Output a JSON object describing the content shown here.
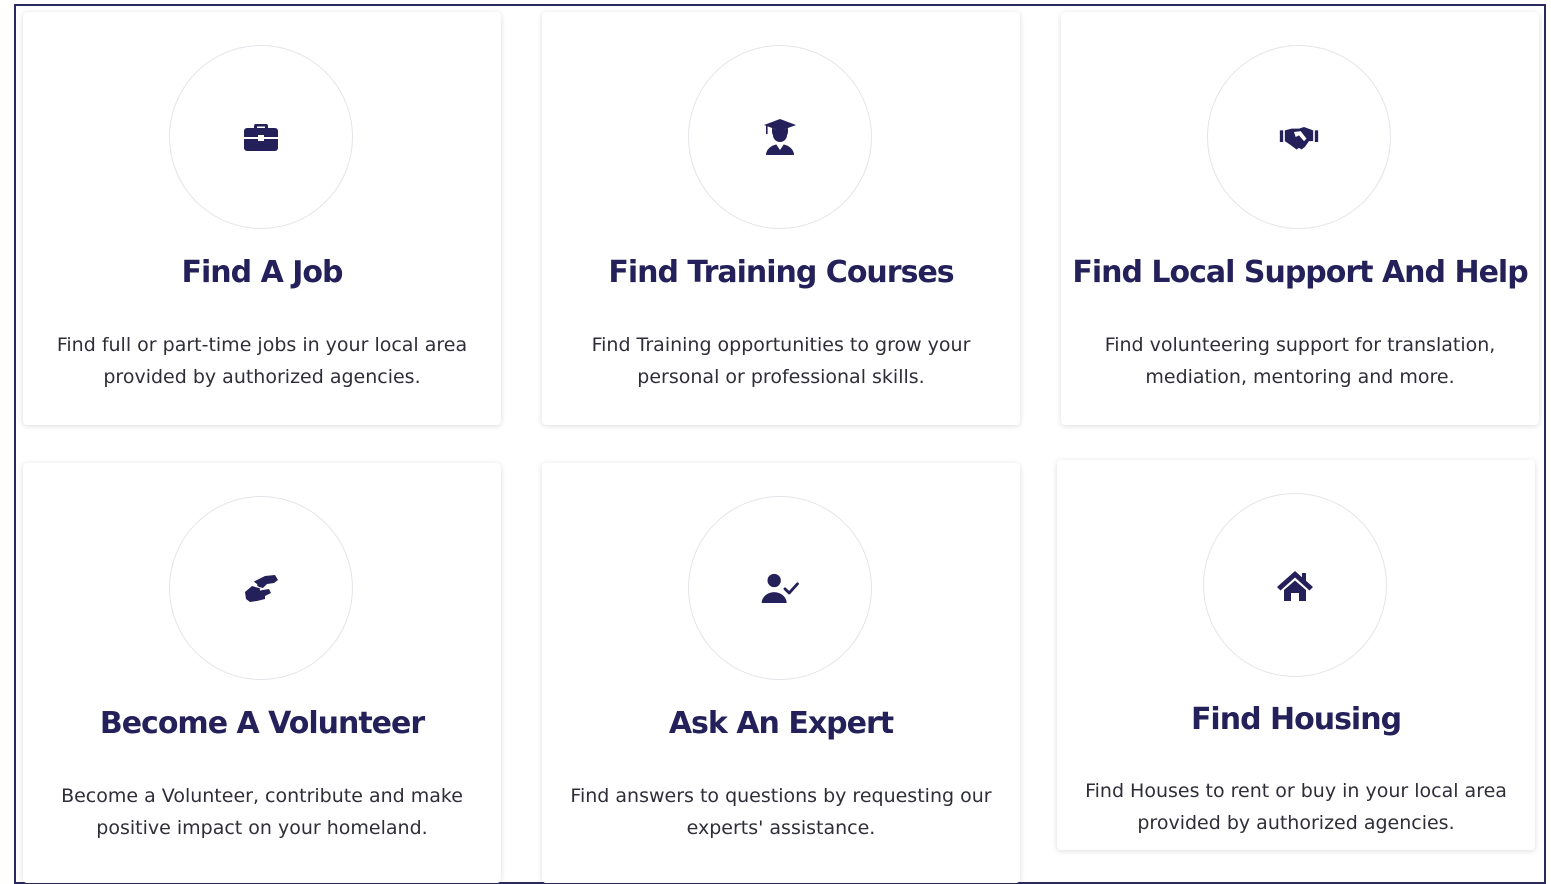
{
  "cards": [
    {
      "title": "Find A Job",
      "description": "Find full or part-time jobs in your local area provided by authorized agencies.",
      "icon": "briefcase-icon"
    },
    {
      "title": "Find Training Courses",
      "description": "Find Training opportunities to grow your personal or professional skills.",
      "icon": "graduate-icon"
    },
    {
      "title": "Find Local Support And Help",
      "description": "Find volunteering support for translation, mediation, mentoring and more.",
      "icon": "handshake-icon"
    },
    {
      "title": "Become A Volunteer",
      "description": "Become a Volunteer, contribute and make positive impact on your homeland.",
      "icon": "hands-helping-icon"
    },
    {
      "title": "Ask An Expert",
      "description": "Find answers to questions by requesting our experts' assistance.",
      "icon": "user-check-icon"
    },
    {
      "title": "Find Housing",
      "description": "Find Houses to rent or buy in your local area provided by authorized agencies.",
      "icon": "home-icon"
    }
  ],
  "colors": {
    "title": "#24215a",
    "icon": "#24215a",
    "text": "#2e2e38",
    "frame_border": "#2b2a5e"
  }
}
